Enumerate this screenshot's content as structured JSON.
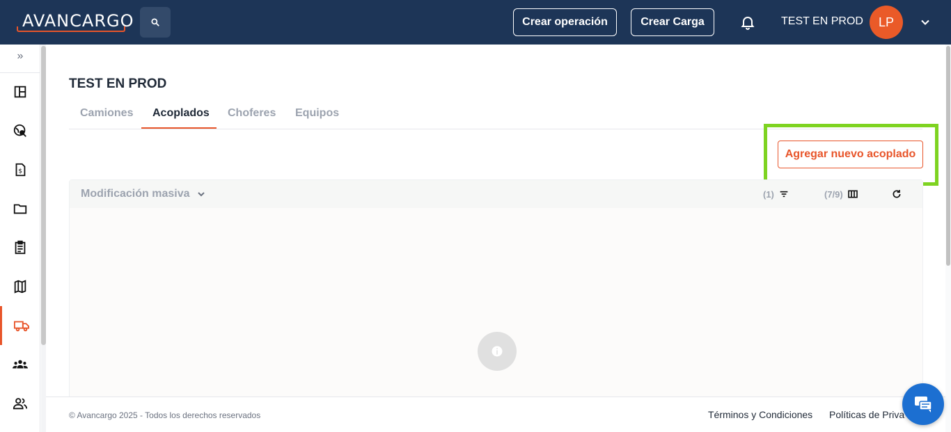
{
  "header": {
    "logo_text": "AVANCARGO",
    "create_operation_label": "Crear operación",
    "create_load_label": "Crear Carga",
    "username": "TEST EN PROD",
    "avatar_initials": "LP",
    "bg_color": "#1d3557",
    "accent_color": "#e8552a"
  },
  "sidebar": {
    "items": [
      {
        "icon": "dashboard-icon"
      },
      {
        "icon": "globe-search-icon"
      },
      {
        "icon": "invoice-icon"
      },
      {
        "icon": "folder-icon"
      },
      {
        "icon": "clipboard-icon"
      },
      {
        "icon": "map-icon"
      },
      {
        "icon": "truck-icon",
        "active": true
      },
      {
        "icon": "group-icon"
      },
      {
        "icon": "users-icon"
      }
    ]
  },
  "page": {
    "title": "TEST EN PROD",
    "tabs": [
      {
        "label": "Camiones"
      },
      {
        "label": "Acoplados",
        "active": true
      },
      {
        "label": "Choferes"
      },
      {
        "label": "Equipos"
      }
    ],
    "add_button_label": "Agregar nuevo acoplado"
  },
  "table": {
    "bulk_label": "Modificación masiva",
    "filter_count": "(1)",
    "columns_count": "(7/9)"
  },
  "footer": {
    "copyright": "© Avancargo 2025 - Todos los derechos reservados",
    "terms_label": "Términos y Condiciones",
    "privacy_label": "Políticas de Priva"
  }
}
